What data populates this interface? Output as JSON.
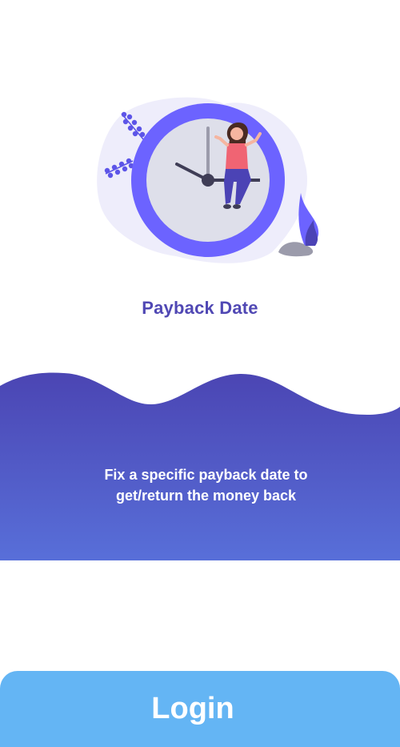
{
  "onboarding": {
    "title": "Payback Date",
    "description": "Fix a specific payback date to get/return the money back"
  },
  "actions": {
    "login_label": "Login"
  },
  "colors": {
    "title": "#5048b4",
    "wave_top": "#4b45b3",
    "wave_bottom": "#586fd9",
    "login_button": "#64b5f4",
    "clock_ring": "#6c63ff"
  },
  "icons": {
    "hero": "clock-woman-illustration"
  }
}
